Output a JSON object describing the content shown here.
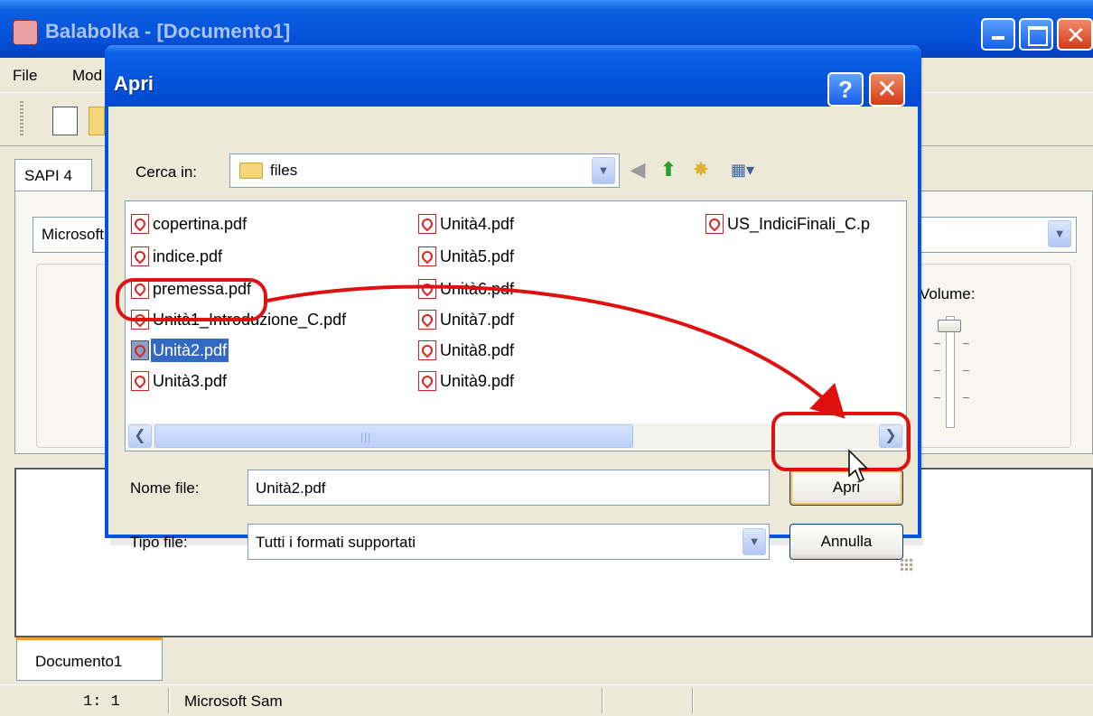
{
  "app": {
    "title": "Balabolka - [Documento1]",
    "menu": [
      "File",
      "Mod"
    ],
    "tab_sapi": "SAPI 4",
    "voice": "Microsoft Sam",
    "volume_label": "Volume:",
    "document_tab": "Documento1",
    "status": {
      "position": "1:  1",
      "voice": "Microsoft Sam"
    }
  },
  "dialog": {
    "title": "Apri",
    "help_glyph": "?",
    "close_glyph": "✕",
    "look_in_label": "Cerca in:",
    "look_in_value": "files",
    "files_col1": [
      "copertina.pdf",
      "indice.pdf",
      "premessa.pdf",
      "Unità1_Introduzione_C.pdf",
      "Unità2.pdf",
      "Unità3.pdf"
    ],
    "files_col2": [
      "Unità4.pdf",
      "Unità5.pdf",
      "Unità6.pdf",
      "Unità7.pdf",
      "Unità8.pdf",
      "Unità9.pdf"
    ],
    "files_col3": [
      "US_IndiciFinali_C.p"
    ],
    "selected_file": "Unità2.pdf",
    "filename_label": "Nome file:",
    "filename_value": "Unità2.pdf",
    "filetype_label": "Tipo file:",
    "filetype_value": "Tutti i formati supportati",
    "open_button": "Apri",
    "cancel_button": "Annulla"
  },
  "icons": {
    "look_in": "folder-icon",
    "nav": [
      "back-icon",
      "up-folder-icon",
      "new-folder-icon",
      "view-menu-icon"
    ],
    "file": "pdf-file-icon"
  },
  "colors": {
    "xp_title_blue": "#0054e3",
    "selection": "#316ac5",
    "annotation_red": "#e01010",
    "close_red": "#d33b1b"
  }
}
